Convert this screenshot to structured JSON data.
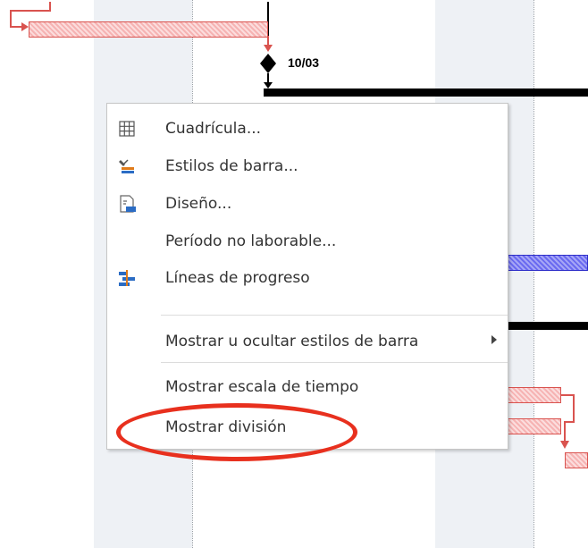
{
  "timeline": {
    "milestone_date": "10/03"
  },
  "context_menu": {
    "items": [
      {
        "label": "Cuadrícula...",
        "icon": "grid-icon"
      },
      {
        "label": "Estilos de barra...",
        "icon": "bar-styles-icon"
      },
      {
        "label": "Diseño...",
        "icon": "layout-icon"
      },
      {
        "label": "Período no laborable...",
        "icon": ""
      },
      {
        "label": "Líneas de progreso",
        "icon": "progress-lines-icon"
      },
      {
        "label": "Mostrar u ocultar estilos de barra",
        "icon": "",
        "submenu": true
      },
      {
        "label": "Mostrar escala de tiempo",
        "icon": ""
      },
      {
        "label": "Mostrar división",
        "icon": ""
      }
    ]
  },
  "colors": {
    "accent_red": "#e8301e",
    "task_pink": "#f6b3b3",
    "task_blue": "#6a6af0",
    "summary_black": "#000000"
  }
}
